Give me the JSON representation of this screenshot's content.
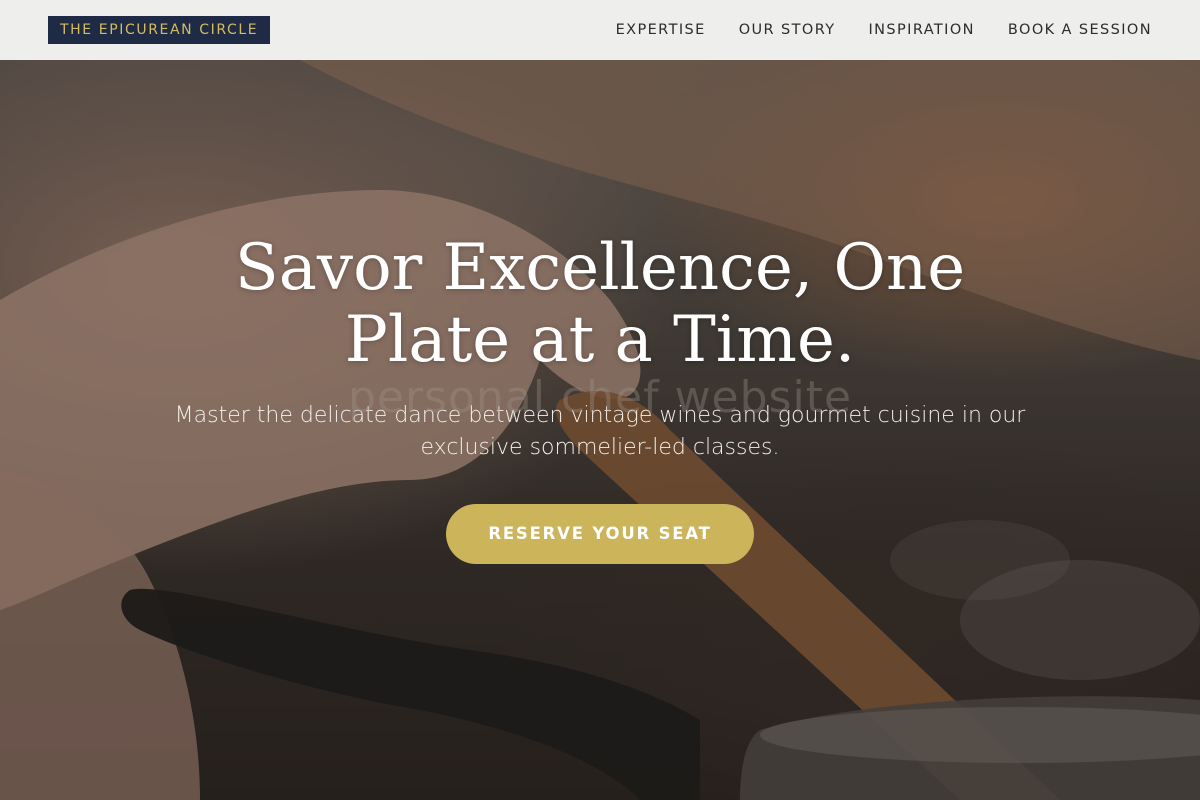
{
  "header": {
    "brand": "THE EPICUREAN CIRCLE",
    "nav": [
      "EXPERTISE",
      "OUR STORY",
      "INSPIRATION",
      "BOOK A SESSION"
    ]
  },
  "hero": {
    "title": "Savor Excellence, One Plate at a Time.",
    "watermark": "personal chef website",
    "subtitle": "Master the delicate dance between vintage wines and gourmet cuisine in our exclusive sommelier-led classes.",
    "cta_label": "RESERVE YOUR SEAT"
  },
  "colors": {
    "brand_bg": "#1f2a44",
    "brand_text": "#d4bc62",
    "cta_bg": "#cbb45a"
  }
}
